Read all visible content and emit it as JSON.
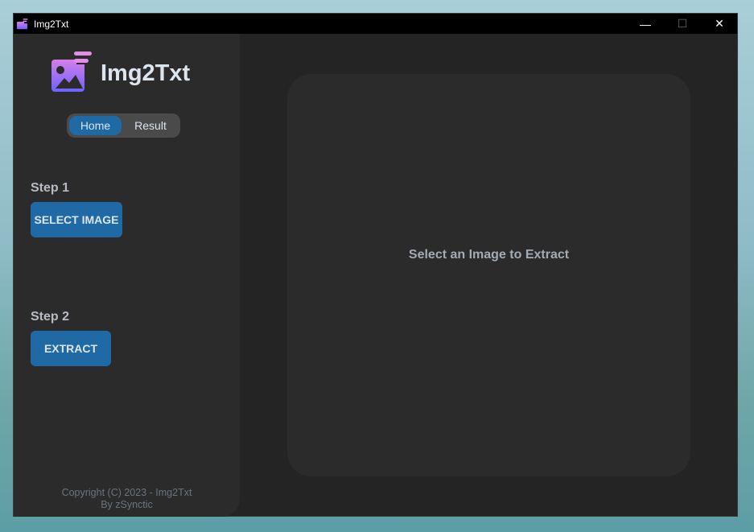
{
  "window": {
    "title": "Img2Txt",
    "minimize": "—",
    "maximize": "☐",
    "close": "✕"
  },
  "sidebar": {
    "app_title": "Img2Txt",
    "tabs": [
      {
        "label": "Home",
        "active": true
      },
      {
        "label": "Result",
        "active": false
      }
    ],
    "step1_label": "Step 1",
    "select_button": "SELECT IMAGE",
    "step2_label": "Step 2",
    "extract_button": "EXTRACT",
    "copyright": "Copyright (C) 2023 - Img2Txt",
    "author": "By zSynctic"
  },
  "main": {
    "placeholder": "Select an Image to Extract"
  },
  "colors": {
    "accent": "#1f6aa5",
    "sidebar": "#2b2b2b",
    "background": "#242424"
  }
}
